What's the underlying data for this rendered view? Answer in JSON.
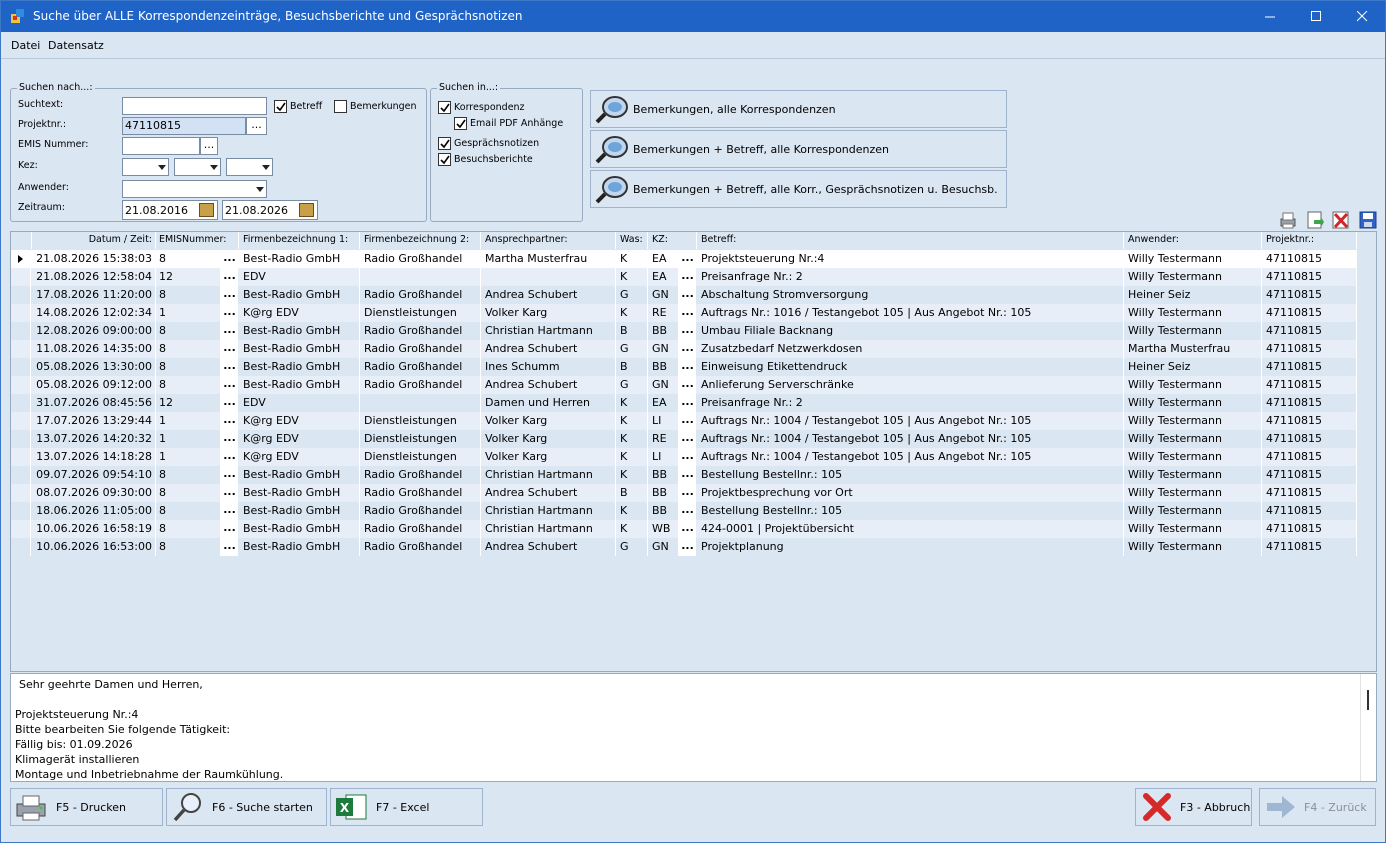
{
  "window": {
    "title": "Suche über ALLE Korrespondenzeinträge, Besuchsberichte und Gesprächsnotizen"
  },
  "menu": [
    {
      "label": "Datei"
    },
    {
      "label": "Datensatz"
    }
  ],
  "search": {
    "group_title": "Suchen nach...:",
    "suchtext_label": "Suchtext:",
    "suchtext_value": "",
    "betreff_label": "Betreff",
    "betreff_checked": true,
    "bemerkungen_label": "Bemerkungen",
    "bemerkungen_checked": false,
    "projektnr_label": "Projektnr.:",
    "projektnr_value": "47110815",
    "emis_label": "EMIS Nummer:",
    "emis_value": "",
    "kez_label": "Kez:",
    "anwender_label": "Anwender:",
    "zeitraum_label": "Zeitraum:",
    "date_from": "21.08.2016",
    "date_to": "21.08.2026",
    "ellipsis": "..."
  },
  "search_in": {
    "group_title": "Suchen in...:",
    "korrespondenz": "Korrespondenz",
    "email_pdf": "Email PDF Anhänge",
    "gespraechsnotizen": "Gesprächsnotizen",
    "besuchsberichte": "Besuchsberichte"
  },
  "quick_buttons": [
    {
      "label": "Bemerkungen, alle Korrespondenzen"
    },
    {
      "label": "Bemerkungen + Betreff, alle Korrespondenzen"
    },
    {
      "label": "Bemerkungen + Betreff, alle Korr., Gesprächsnotizen u. Besuchsb."
    }
  ],
  "grid": {
    "columns": [
      "Datum / Zeit:",
      "EMISNummer:",
      "Firmenbezeichnung 1:",
      "Firmenbezeichnung 2:",
      "Ansprechpartner:",
      "Was:",
      "KZ:",
      "Betreff:",
      "Anwender:",
      "Projektnr.:"
    ],
    "rows": [
      [
        "21.08.2026 15:38:03",
        "8",
        "Best-Radio GmbH",
        "Radio Großhandel",
        "Martha Musterfrau",
        "K",
        "EA",
        "Projektsteuerung Nr.:4",
        "Willy Testermann",
        "47110815"
      ],
      [
        "21.08.2026 12:58:04",
        "12",
        "EDV",
        "",
        "",
        "K",
        "EA",
        "Preisanfrage Nr.: 2",
        "Willy Testermann",
        "47110815"
      ],
      [
        "17.08.2026 11:20:00",
        "8",
        "Best-Radio GmbH",
        "Radio Großhandel",
        "Andrea Schubert",
        "G",
        "GN",
        "Abschaltung Stromversorgung",
        "Heiner Seiz",
        "47110815"
      ],
      [
        "14.08.2026 12:02:34",
        "1",
        "K@rg EDV",
        "Dienstleistungen",
        "Volker Karg",
        "K",
        "RE",
        "Auftrags Nr.: 1016 / Testangebot 105 | Aus Angebot Nr.: 105",
        "Willy Testermann",
        "47110815"
      ],
      [
        "12.08.2026 09:00:00",
        "8",
        "Best-Radio GmbH",
        "Radio Großhandel",
        "Christian Hartmann",
        "B",
        "BB",
        "Umbau Filiale Backnang",
        "Willy Testermann",
        "47110815"
      ],
      [
        "11.08.2026 14:35:00",
        "8",
        "Best-Radio GmbH",
        "Radio Großhandel",
        "Andrea Schubert",
        "G",
        "GN",
        "Zusatzbedarf Netzwerkdosen",
        "Martha Musterfrau",
        "47110815"
      ],
      [
        "05.08.2026 13:30:00",
        "8",
        "Best-Radio GmbH",
        "Radio Großhandel",
        "Ines Schumm",
        "B",
        "BB",
        "Einweisung Etikettendruck",
        "Heiner Seiz",
        "47110815"
      ],
      [
        "05.08.2026 09:12:00",
        "8",
        "Best-Radio GmbH",
        "Radio Großhandel",
        "Andrea Schubert",
        "G",
        "GN",
        "Anlieferung Serverschränke",
        "Willy Testermann",
        "47110815"
      ],
      [
        "31.07.2026 08:45:56",
        "12",
        "EDV",
        "",
        "Damen und Herren",
        "K",
        "EA",
        "Preisanfrage Nr.: 2",
        "Willy Testermann",
        "47110815"
      ],
      [
        "17.07.2026 13:29:44",
        "1",
        "K@rg EDV",
        "Dienstleistungen",
        "Volker Karg",
        "K",
        "LI",
        "Auftrags Nr.: 1004 / Testangebot 105 | Aus Angebot Nr.: 105",
        "Willy Testermann",
        "47110815"
      ],
      [
        "13.07.2026 14:20:32",
        "1",
        "K@rg EDV",
        "Dienstleistungen",
        "Volker Karg",
        "K",
        "RE",
        "Auftrags Nr.: 1004 / Testangebot 105 | Aus Angebot Nr.: 105",
        "Willy Testermann",
        "47110815"
      ],
      [
        "13.07.2026 14:18:28",
        "1",
        "K@rg EDV",
        "Dienstleistungen",
        "Volker Karg",
        "K",
        "LI",
        "Auftrags Nr.: 1004 / Testangebot 105 | Aus Angebot Nr.: 105",
        "Willy Testermann",
        "47110815"
      ],
      [
        "09.07.2026 09:54:10",
        "8",
        "Best-Radio GmbH",
        "Radio Großhandel",
        "Christian Hartmann",
        "K",
        "BB",
        "Bestellung Bestellnr.: 105",
        "Willy Testermann",
        "47110815"
      ],
      [
        "08.07.2026 09:30:00",
        "8",
        "Best-Radio GmbH",
        "Radio Großhandel",
        "Andrea Schubert",
        "B",
        "BB",
        "Projektbesprechung vor Ort",
        "Willy Testermann",
        "47110815"
      ],
      [
        "18.06.2026 11:05:00",
        "8",
        "Best-Radio GmbH",
        "Radio Großhandel",
        "Christian Hartmann",
        "K",
        "BB",
        "Bestellung Bestellnr.: 105",
        "Willy Testermann",
        "47110815"
      ],
      [
        "10.06.2026 16:58:19",
        "8",
        "Best-Radio GmbH",
        "Radio Großhandel",
        "Christian Hartmann",
        "K",
        "WB",
        "424-0001 | Projektübersicht",
        "Willy Testermann",
        "47110815"
      ],
      [
        "10.06.2026 16:53:00",
        "8",
        "Best-Radio GmbH",
        "Radio Großhandel",
        "Andrea Schubert",
        "G",
        "GN",
        "Projektplanung",
        "Willy Testermann",
        "47110815"
      ]
    ],
    "ellipsis": "..."
  },
  "memo": {
    "lines": [
      "Sehr geehrte Damen und Herren,",
      "",
      "Projektsteuerung Nr.:4",
      "Bitte bearbeiten Sie folgende Tätigkeit:",
      "Fällig bis: 01.09.2026",
      "Klimagerät installieren",
      "Montage und Inbetriebnahme der Raumkühlung."
    ]
  },
  "footer": {
    "print_label": "F5 - Drucken",
    "search_label": "F6 - Suche starten",
    "excel_label": "F7 - Excel",
    "cancel_label": "F3 - Abbruch",
    "back_label": "F4 - Zurück"
  }
}
